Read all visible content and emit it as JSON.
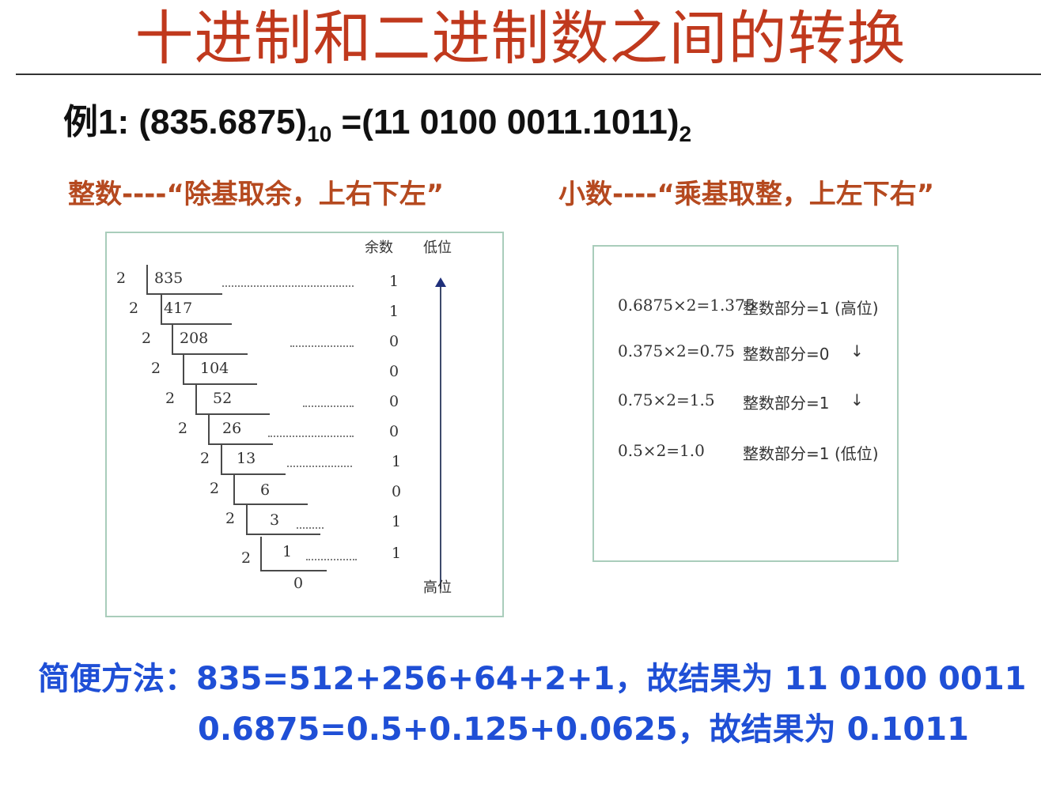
{
  "title": "十进制和二进制数之间的转换",
  "example": {
    "prefix": "例1: (835.6875)",
    "base_from": "10",
    "middle": " =(11 0100 0011.1011)",
    "base_to": "2"
  },
  "rules": {
    "integer": "整数----“除基取余，上右下左”",
    "fraction": "小数----“乘基取整，上左下右”"
  },
  "integer_box": {
    "header_remainder": "余数",
    "header_low": "低位",
    "label_high": "高位",
    "divisor": "2",
    "rows": [
      {
        "quotient": "835",
        "remainder": "1"
      },
      {
        "quotient": "417",
        "remainder": "1"
      },
      {
        "quotient": "208",
        "remainder": "0"
      },
      {
        "quotient": "104",
        "remainder": "0"
      },
      {
        "quotient": "52",
        "remainder": "0"
      },
      {
        "quotient": "26",
        "remainder": "0"
      },
      {
        "quotient": "13",
        "remainder": "1"
      },
      {
        "quotient": "6",
        "remainder": "0"
      },
      {
        "quotient": "3",
        "remainder": "1"
      },
      {
        "quotient": "1",
        "remainder": "1"
      }
    ],
    "final_quotient": "0"
  },
  "fraction_box": {
    "rows": [
      {
        "expr": "0.6875×2=1.375",
        "part": "整数部分=1",
        "note": "(高位)"
      },
      {
        "expr": "0.375×2=0.75",
        "part": "整数部分=0",
        "note": "↓"
      },
      {
        "expr": "0.75×2=1.5",
        "part": "整数部分=1",
        "note": "↓"
      },
      {
        "expr": "0.5×2=1.0",
        "part": "整数部分=1",
        "note": "(低位)"
      }
    ]
  },
  "shortcut": {
    "line1": "简便方法：835=512+256+64+2+1，故结果为 11 0100 0011",
    "line2": "0.6875=0.5+0.125+0.0625，故结果为 0.1011"
  }
}
